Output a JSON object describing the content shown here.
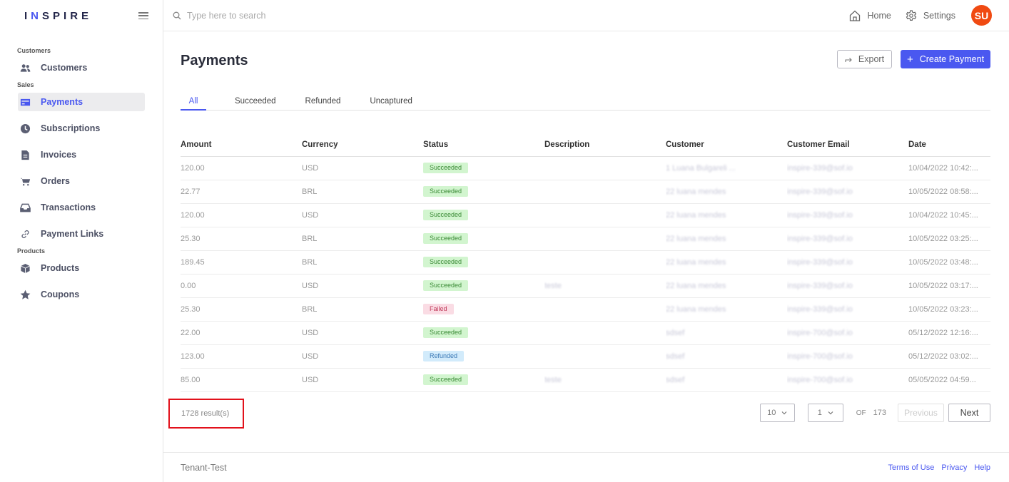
{
  "app": {
    "logo_pre": "I",
    "logo_accent": "N",
    "logo_post": "SPIRE"
  },
  "sidebar": {
    "sections": [
      {
        "label": "Customers"
      },
      {
        "label": "Sales"
      },
      {
        "label": "Products"
      }
    ],
    "items": [
      {
        "label": "Customers",
        "icon": "users-icon"
      },
      {
        "label": "Payments",
        "icon": "credit-card-icon",
        "active": true
      },
      {
        "label": "Subscriptions",
        "icon": "clock-icon"
      },
      {
        "label": "Invoices",
        "icon": "document-icon"
      },
      {
        "label": "Orders",
        "icon": "cart-icon"
      },
      {
        "label": "Transactions",
        "icon": "inbox-icon"
      },
      {
        "label": "Payment Links",
        "icon": "link-icon"
      },
      {
        "label": "Products",
        "icon": "box-icon"
      },
      {
        "label": "Coupons",
        "icon": "star-icon"
      }
    ]
  },
  "topbar": {
    "search_placeholder": "Type here to search",
    "home_label": "Home",
    "settings_label": "Settings",
    "avatar_initials": "SU",
    "avatar_color": "#f04a12"
  },
  "page": {
    "title": "Payments",
    "export_label": "Export",
    "create_label": "Create Payment",
    "accent_color": "#4a58f0"
  },
  "tabs": [
    {
      "label": "All",
      "active": true
    },
    {
      "label": "Succeeded"
    },
    {
      "label": "Refunded"
    },
    {
      "label": "Uncaptured"
    }
  ],
  "table": {
    "headers": [
      "Amount",
      "Currency",
      "Status",
      "Description",
      "Customer",
      "Customer Email",
      "Date"
    ],
    "rows": [
      {
        "amount": "120.00",
        "currency": "USD",
        "status": "Succeeded",
        "status_kind": "succeeded",
        "description": "",
        "customer": "1 Luana Bulgareli ...",
        "email": "inspire-339@sof.io",
        "date": "10/04/2022 10:42:..."
      },
      {
        "amount": "22.77",
        "currency": "BRL",
        "status": "Succeeded",
        "status_kind": "succeeded",
        "description": "",
        "customer": "22 luana mendes",
        "email": "inspire-339@sof.io",
        "date": "10/05/2022 08:58:..."
      },
      {
        "amount": "120.00",
        "currency": "USD",
        "status": "Succeeded",
        "status_kind": "succeeded",
        "description": "",
        "customer": "22 luana mendes",
        "email": "inspire-339@sof.io",
        "date": "10/04/2022 10:45:..."
      },
      {
        "amount": "25.30",
        "currency": "BRL",
        "status": "Succeeded",
        "status_kind": "succeeded",
        "description": "",
        "customer": "22 luana mendes",
        "email": "inspire-339@sof.io",
        "date": "10/05/2022 03:25:..."
      },
      {
        "amount": "189.45",
        "currency": "BRL",
        "status": "Succeeded",
        "status_kind": "succeeded",
        "description": "",
        "customer": "22 luana mendes",
        "email": "inspire-339@sof.io",
        "date": "10/05/2022 03:48:..."
      },
      {
        "amount": "0.00",
        "currency": "USD",
        "status": "Succeeded",
        "status_kind": "succeeded",
        "description": "teste",
        "customer": "22 luana mendes",
        "email": "inspire-339@sof.io",
        "date": "10/05/2022 03:17:..."
      },
      {
        "amount": "25.30",
        "currency": "BRL",
        "status": "Failed",
        "status_kind": "failed",
        "description": "",
        "customer": "22 luana mendes",
        "email": "inspire-339@sof.io",
        "date": "10/05/2022 03:23:..."
      },
      {
        "amount": "22.00",
        "currency": "USD",
        "status": "Succeeded",
        "status_kind": "succeeded",
        "description": "",
        "customer": "sdsef",
        "email": "inspire-700@sof.io",
        "date": "05/12/2022 12:16:..."
      },
      {
        "amount": "123.00",
        "currency": "USD",
        "status": "Refunded",
        "status_kind": "refunded",
        "description": "",
        "customer": "sdsef",
        "email": "inspire-700@sof.io",
        "date": "05/12/2022 03:02:..."
      },
      {
        "amount": "85.00",
        "currency": "USD",
        "status": "Succeeded",
        "status_kind": "succeeded",
        "description": "teste",
        "customer": "sdsef",
        "email": "inspire-700@sof.io",
        "date": "05/05/2022 04:59..."
      }
    ]
  },
  "pagination": {
    "results_label": "1728 result(s)",
    "page_size": "10",
    "current_page": "1",
    "of_label": "OF",
    "total_pages": "173",
    "prev_label": "Previous",
    "next_label": "Next"
  },
  "footer": {
    "tenant": "Tenant-Test",
    "links": [
      "Terms of Use",
      "Privacy",
      "Help"
    ]
  }
}
